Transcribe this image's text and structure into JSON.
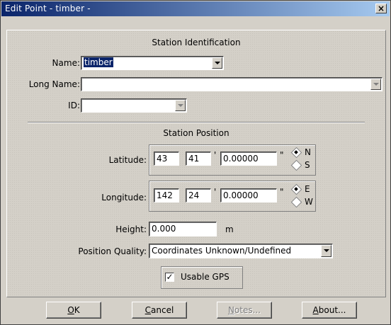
{
  "window": {
    "title": "Edit Point - timber -",
    "close_glyph": "×"
  },
  "identification": {
    "section_title": "Station Identification",
    "name_label": "Name:",
    "name_value": "timber",
    "long_name_label": "Long Name:",
    "long_name_value": "",
    "id_label": "ID:",
    "id_value": ""
  },
  "position": {
    "section_title": "Station Position",
    "latitude_label": "Latitude:",
    "latitude": {
      "deg": "43",
      "min": "41",
      "min_mark": "'",
      "sec": "0.00000",
      "sec_mark": "\""
    },
    "lat_n": "N",
    "lat_s": "S",
    "lat_selected": "N",
    "longitude_label": "Longitude:",
    "longitude": {
      "deg": "142",
      "min": "24",
      "min_mark": "'",
      "sec": "0.00000",
      "sec_mark": "\""
    },
    "lon_e": "E",
    "lon_w": "W",
    "lon_selected": "E",
    "height_label": "Height:",
    "height_value": "0.000",
    "height_unit": "m",
    "quality_label": "Position Quality:",
    "quality_value": "Coordinates Unknown/Undefined",
    "usable_gps_label": "Usable GPS",
    "usable_gps_checked": true,
    "check_glyph": "✓"
  },
  "buttons": {
    "ok": {
      "underline": "O",
      "rest": "K"
    },
    "cancel": {
      "underline": "C",
      "rest": "ancel"
    },
    "notes": {
      "underline": "N",
      "rest": "otes..."
    },
    "about": {
      "underline": "A",
      "rest": "bout..."
    }
  }
}
